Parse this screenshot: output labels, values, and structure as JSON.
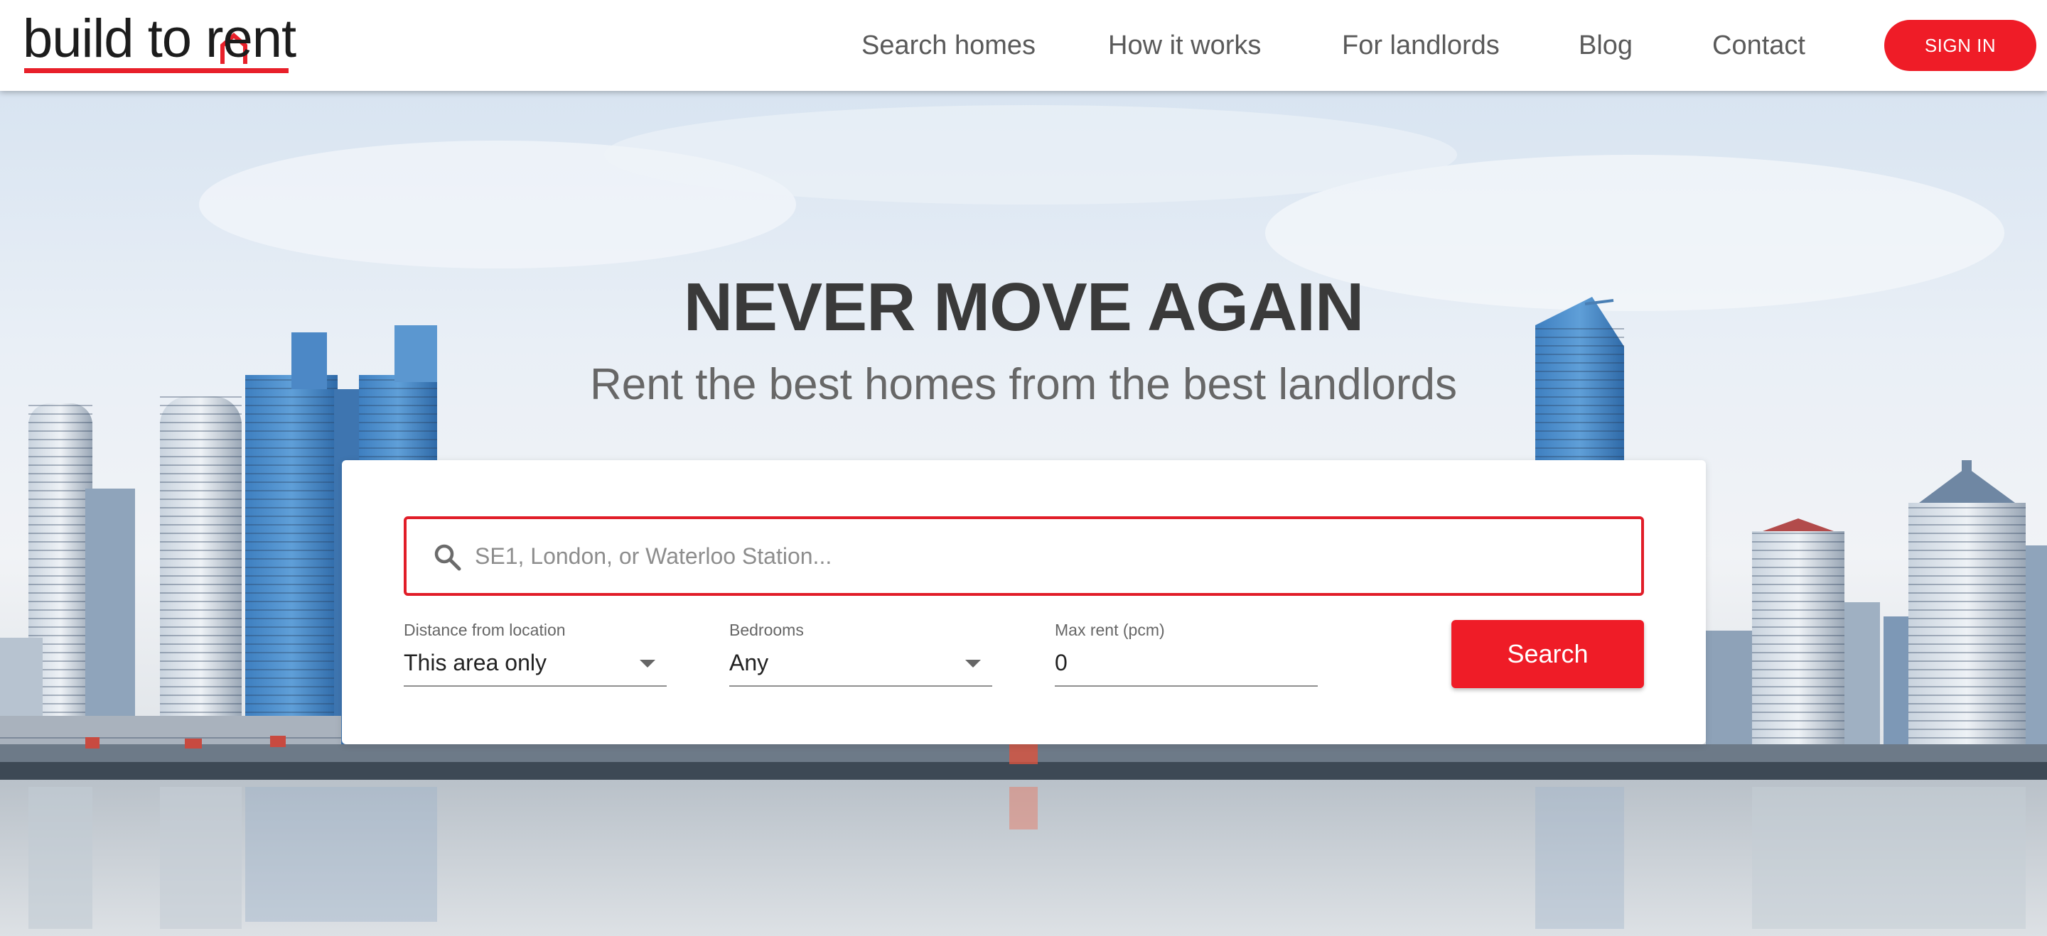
{
  "brand": {
    "logo_text": "build to rent",
    "accent_color": "#ef1c27"
  },
  "nav": {
    "items": [
      "Search homes",
      "How it works",
      "For landlords",
      "Blog",
      "Contact"
    ],
    "signin_label": "SIGN IN"
  },
  "hero": {
    "headline": "NEVER MOVE AGAIN",
    "subheadline": "Rent the best homes from the best landlords"
  },
  "search": {
    "placeholder": "SE1, London, or Waterloo Station...",
    "icon": "search-icon",
    "filters": {
      "distance": {
        "label": "Distance from location",
        "value": "This area only"
      },
      "bedrooms": {
        "label": "Bedrooms",
        "value": "Any"
      },
      "max_rent": {
        "label": "Max rent (pcm)",
        "value": "0"
      }
    },
    "button_label": "Search"
  }
}
